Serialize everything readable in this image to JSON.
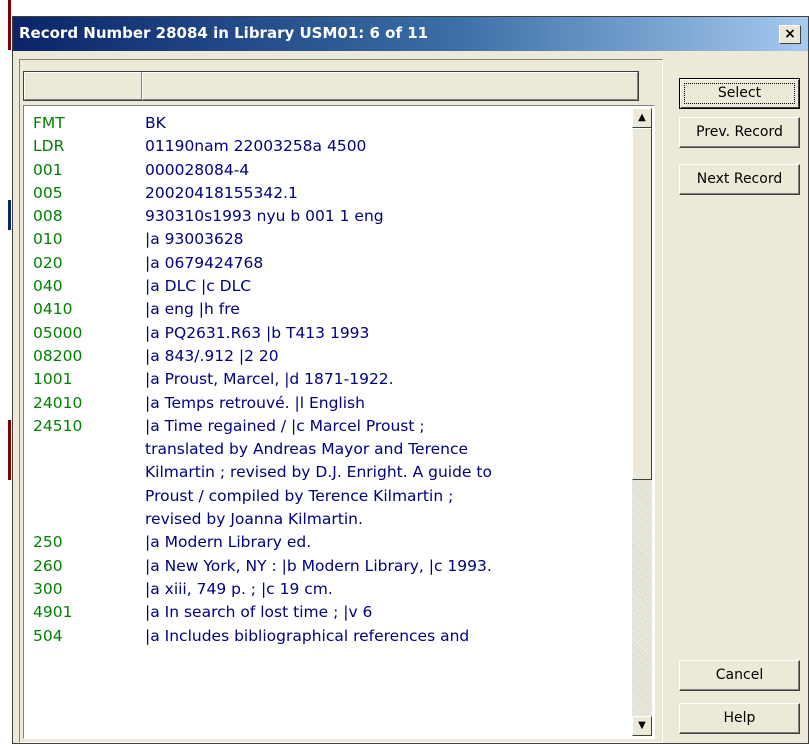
{
  "window": {
    "title": "Record Number 28084 in Library USM01: 6 of 11",
    "close_label": "×"
  },
  "record_table": {
    "columns": [
      "",
      ""
    ],
    "rows": [
      {
        "tag": "FMT",
        "value": [
          "BK"
        ]
      },
      {
        "tag": "LDR",
        "value": [
          "01190nam  22003258a 4500"
        ]
      },
      {
        "tag": "001",
        "value": [
          "000028084-4"
        ]
      },
      {
        "tag": "005",
        "value": [
          "20020418155342.1"
        ]
      },
      {
        "tag": "008",
        "value": [
          "930310s1993    nyu      b    001 1 eng"
        ]
      },
      {
        "tag": "010",
        "value": [
          "|a   93003628"
        ]
      },
      {
        "tag": "020",
        "value": [
          "|a 0679424768"
        ]
      },
      {
        "tag": "040",
        "value": [
          "|a DLC |c DLC"
        ]
      },
      {
        "tag": "0410",
        "value": [
          "|a eng |h fre"
        ]
      },
      {
        "tag": "05000",
        "value": [
          "|a PQ2631.R63 |b T413 1993"
        ]
      },
      {
        "tag": "08200",
        "value": [
          "|a 843/.912 |2 20"
        ]
      },
      {
        "tag": "1001",
        "value": [
          "|a Proust, Marcel, |d 1871-1922."
        ]
      },
      {
        "tag": "24010",
        "value": [
          "|a Temps retrouvé. |l English"
        ]
      },
      {
        "tag": "24510",
        "value": [
          "|a Time regained / |c Marcel Proust ;",
          "translated by Andreas Mayor and Terence",
          "Kilmartin ; revised by D.J. Enright. A guide to",
          "Proust / compiled by Terence Kilmartin ;",
          "revised by Joanna Kilmartin."
        ]
      },
      {
        "tag": "250",
        "value": [
          "|a Modern Library ed."
        ]
      },
      {
        "tag": "260",
        "value": [
          "|a New York, NY : |b Modern Library, |c 1993."
        ]
      },
      {
        "tag": "300",
        "value": [
          "|a xiii, 749 p. ; |c 19 cm."
        ]
      },
      {
        "tag": "4901",
        "value": [
          "|a In search of lost time ; |v 6"
        ]
      },
      {
        "tag": "504",
        "value": [
          "|a Includes bibliographical references and"
        ]
      }
    ]
  },
  "buttons": {
    "select": "Select",
    "prev_record": "Prev. Record",
    "next_record": "Next Record",
    "cancel": "Cancel",
    "help": "Help"
  },
  "colors": {
    "title_bar": "#0a246a",
    "tag_text": "#008000",
    "value_text": "#000080",
    "dialog_face": "#ece9d8"
  },
  "icons": {
    "scroll_up": "triangle-up-icon",
    "scroll_down": "triangle-down-icon",
    "close": "close-icon"
  }
}
